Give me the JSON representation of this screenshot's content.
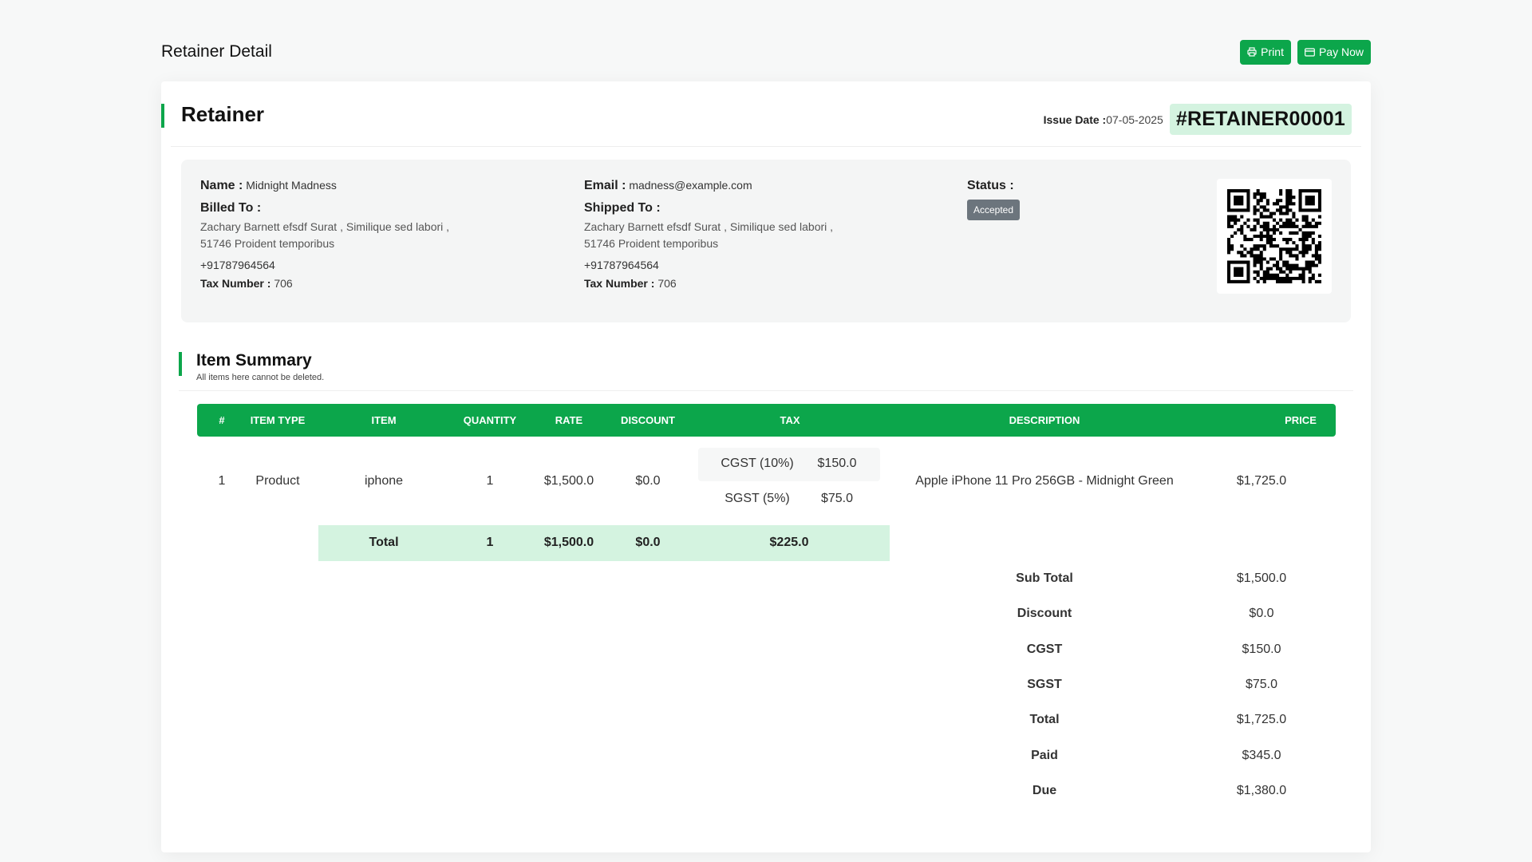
{
  "header": {
    "title": "Retainer Detail",
    "print_label": "Print",
    "pay_now_label": "Pay Now"
  },
  "card": {
    "title": "Retainer",
    "issue_date_label": "Issue Date :",
    "issue_date": "07-05-2025",
    "retainer_number": "#RETAINER00001"
  },
  "billing": {
    "name_label": "Name :",
    "name": "Midnight Madness",
    "email_label": "Email :",
    "email": "madness@example.com",
    "billed_to_label": "Billed To :",
    "billed_address_1": "Zachary Barnett efsdf Surat , Similique sed labori ,",
    "billed_address_2": "51746 Proident temporibus",
    "billed_phone": "+91787964564",
    "billed_tax_label": "Tax Number :",
    "billed_tax": "706",
    "shipped_to_label": "Shipped To :",
    "shipped_address_1": "Zachary Barnett efsdf Surat , Similique sed labori ,",
    "shipped_address_2": "51746 Proident temporibus",
    "shipped_phone": "+91787964564",
    "shipped_tax_label": "Tax Number :",
    "shipped_tax": "706",
    "status_label": "Status :",
    "status": "Accepted"
  },
  "summary": {
    "title": "Item Summary",
    "subtitle": "All items here cannot be deleted.",
    "columns": [
      "#",
      "ITEM TYPE",
      "ITEM",
      "QUANTITY",
      "RATE",
      "DISCOUNT",
      "TAX",
      "DESCRIPTION",
      "PRICE"
    ],
    "row": {
      "num": "1",
      "item_type": "Product",
      "item": "iphone",
      "quantity": "1",
      "rate": "$1,500.0",
      "discount": "$0.0",
      "taxes": [
        {
          "name": "CGST (10%)",
          "amount": "$150.0"
        },
        {
          "name": "SGST (5%)",
          "amount": "$75.0"
        }
      ],
      "description": "Apple iPhone 11 Pro 256GB - Midnight Green",
      "price": "$1,725.0"
    },
    "total_row": {
      "label": "Total",
      "quantity": "1",
      "rate": "$1,500.0",
      "discount": "$0.0",
      "tax": "$225.0"
    },
    "totals": [
      {
        "label": "Sub Total",
        "value": "$1,500.0"
      },
      {
        "label": "Discount",
        "value": "$0.0"
      },
      {
        "label": "CGST",
        "value": "$150.0"
      },
      {
        "label": "SGST",
        "value": "$75.0"
      },
      {
        "label": "Total",
        "value": "$1,725.0"
      },
      {
        "label": "Paid",
        "value": "$345.0"
      },
      {
        "label": "Due",
        "value": "$1,380.0"
      }
    ]
  },
  "colors": {
    "accent": "#0ca64b",
    "accent_light": "#d4f3e0",
    "status_badge": "#6c757d"
  },
  "icons": {
    "print": "printer-icon",
    "pay": "credit-card-icon"
  }
}
